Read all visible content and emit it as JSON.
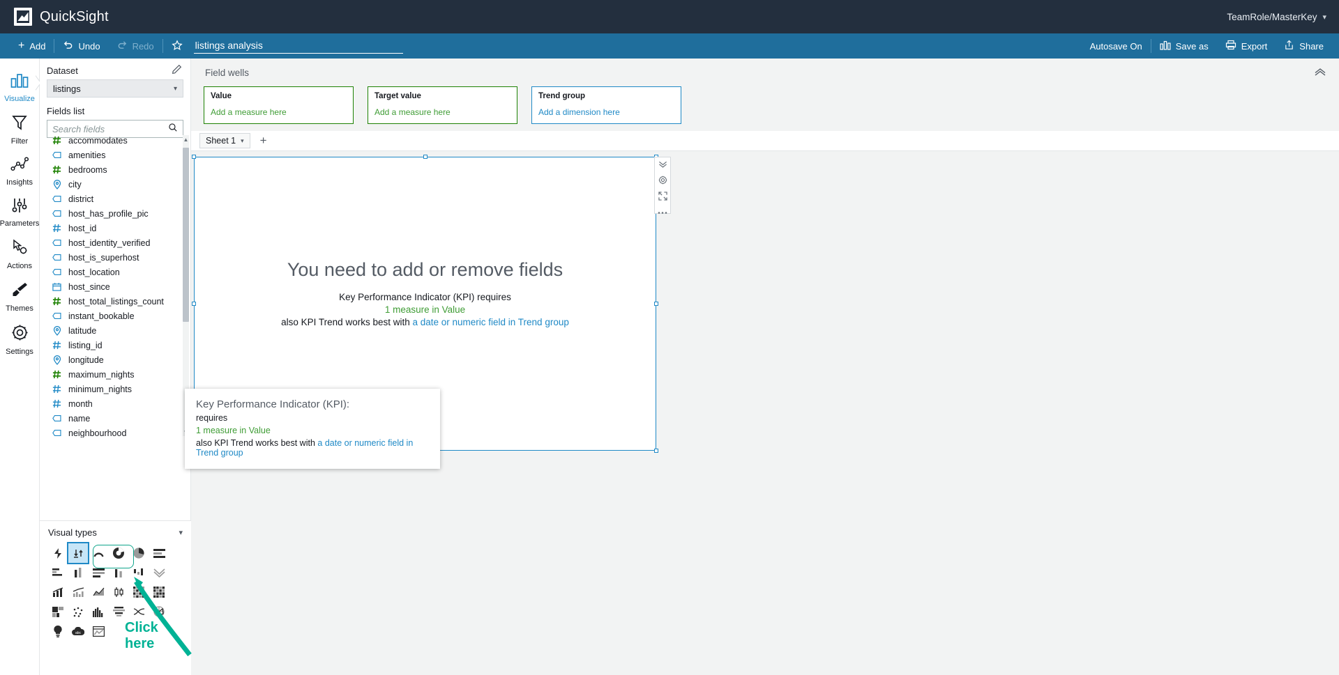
{
  "app": {
    "brand": "QuickSight",
    "logo_icon": "quicksight-logo-icon",
    "account": "TeamRole/MasterKey",
    "account_caret_icon": "chevron-down-icon"
  },
  "toolbar": {
    "add_label": "Add",
    "add_icon": "plus-icon",
    "undo_label": "Undo",
    "undo_icon": "undo-icon",
    "redo_label": "Redo",
    "redo_icon": "redo-icon",
    "favorite_icon": "star-icon",
    "title_value": "listings analysis",
    "title_placeholder": "Analysis name",
    "autosave_label": "Autosave On",
    "save_as_label": "Save as",
    "save_as_icon": "chart-bars-icon",
    "export_label": "Export",
    "export_icon": "printer-icon",
    "share_label": "Share",
    "share_icon": "share-upload-icon"
  },
  "rail": {
    "items": [
      {
        "label": "Visualize",
        "icon": "bar-chart-icon",
        "active": true
      },
      {
        "label": "Filter",
        "icon": "funnel-icon",
        "active": false
      },
      {
        "label": "Insights",
        "icon": "insights-icon",
        "active": false
      },
      {
        "label": "Parameters",
        "icon": "sliders-icon",
        "active": false
      },
      {
        "label": "Actions",
        "icon": "cursor-gear-icon",
        "active": false
      },
      {
        "label": "Themes",
        "icon": "paintbrush-icon",
        "active": false
      },
      {
        "label": "Settings",
        "icon": "gear-icon",
        "active": false
      }
    ]
  },
  "panel": {
    "dataset_label": "Dataset",
    "dataset_value": "listings",
    "dataset_caret_icon": "chevron-down-icon",
    "edit_icon": "pencil-icon",
    "fields_label": "Fields list",
    "search_placeholder": "Search fields",
    "search_value": "",
    "search_icon": "search-icon",
    "fields": [
      {
        "name": "accommodates",
        "type": "measure-green"
      },
      {
        "name": "amenities",
        "type": "dimension-string"
      },
      {
        "name": "bedrooms",
        "type": "measure-green"
      },
      {
        "name": "city",
        "type": "geo"
      },
      {
        "name": "district",
        "type": "dimension-string"
      },
      {
        "name": "host_has_profile_pic",
        "type": "dimension-string"
      },
      {
        "name": "host_id",
        "type": "dimension-number"
      },
      {
        "name": "host_identity_verified",
        "type": "dimension-string"
      },
      {
        "name": "host_is_superhost",
        "type": "dimension-string"
      },
      {
        "name": "host_location",
        "type": "dimension-string"
      },
      {
        "name": "host_since",
        "type": "date"
      },
      {
        "name": "host_total_listings_count",
        "type": "measure-green"
      },
      {
        "name": "instant_bookable",
        "type": "dimension-string"
      },
      {
        "name": "latitude",
        "type": "geo"
      },
      {
        "name": "listing_id",
        "type": "dimension-number"
      },
      {
        "name": "longitude",
        "type": "geo"
      },
      {
        "name": "maximum_nights",
        "type": "measure-green"
      },
      {
        "name": "minimum_nights",
        "type": "dimension-number"
      },
      {
        "name": "month",
        "type": "dimension-number"
      },
      {
        "name": "name",
        "type": "dimension-string"
      },
      {
        "name": "neighbourhood",
        "type": "dimension-string"
      }
    ]
  },
  "visual_types": {
    "label": "Visual types",
    "collapse_icon": "chevron-down-icon",
    "selected_index": 1,
    "highlight_note": "Click here",
    "items": [
      "autograph-icon",
      "kpi-icon",
      "gauge-icon",
      "donut-chart-icon",
      "pie-chart-icon",
      "bar-stacked-horizontal-icon",
      "bar-horizontal-icon",
      "bar-vertical-icon",
      "bar-stacked-100-icon",
      "bar-clustered-icon",
      "waterfall-icon",
      "funnel-icon",
      "line-bar-combo-icon",
      "line-bar-combo-stacked-icon",
      "area-line-icon",
      "box-plot-icon",
      "heat-map-icon",
      "pivot-table-icon",
      "treemap-icon",
      "scatter-plot-icon",
      "histogram-icon",
      "table-icon",
      "sankey-icon",
      "radar-icon",
      "insight-bulb-icon",
      "word-cloud-icon",
      "custom-visual-icon"
    ]
  },
  "field_wells": {
    "title": "Field wells",
    "collapse_icon": "chevron-up-icon",
    "wells": [
      {
        "label": "Value",
        "hint": "Add a measure here",
        "color": "green"
      },
      {
        "label": "Target value",
        "hint": "Add a measure here",
        "color": "green"
      },
      {
        "label": "Trend group",
        "hint": "Add a dimension here",
        "color": "blue"
      }
    ]
  },
  "sheet": {
    "tab_label": "Sheet 1",
    "tab_caret_icon": "chevron-down-icon",
    "add_icon": "plus-icon"
  },
  "visual": {
    "menu_icons": [
      "chevrons-down-icon",
      "settings-gear-icon",
      "expand-icon",
      "more-options-icon"
    ],
    "empty": {
      "title": "You need to add or remove fields",
      "line1": "Key Performance Indicator (KPI) requires",
      "line2": "1 measure in Value",
      "line3_prefix": "also KPI Trend works best with ",
      "line3_link": "a date or numeric field in Trend group"
    }
  },
  "tooltip": {
    "title": "Key Performance Indicator (KPI):",
    "line1": "requires",
    "line2": "1 measure in Value",
    "line3_prefix": "also KPI Trend works best with ",
    "line3_link": "a date or numeric field in Trend group"
  },
  "colors": {
    "topbar_bg": "#232f3e",
    "toolbar_bg": "#1f6e9c",
    "accent_blue": "#1f89c6",
    "measure_green": "#3f9c35",
    "well_green_border": "#1d8102",
    "annotation_teal": "#00b295",
    "canvas_bg": "#f2f3f3"
  }
}
